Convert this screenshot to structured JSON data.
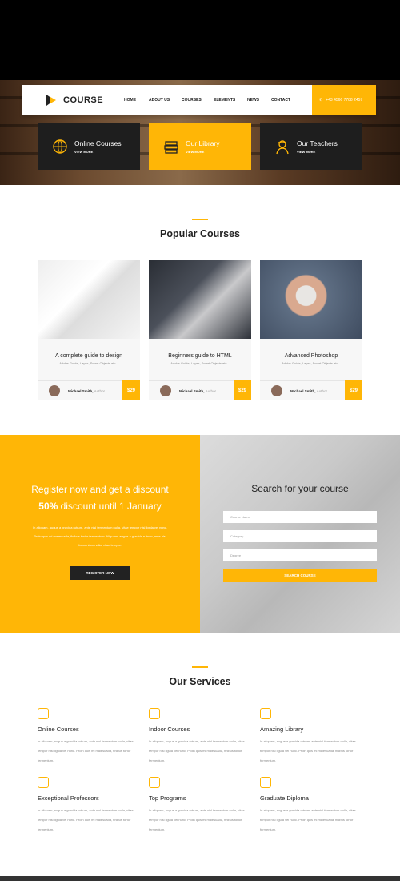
{
  "header": {
    "logo_text": "COURSE",
    "nav": [
      "HOME",
      "ABOUT US",
      "COURSES",
      "ELEMENTS",
      "NEWS",
      "CONTACT"
    ],
    "phone": "+43 4566 7788 2457"
  },
  "features": [
    {
      "title": "Online Courses",
      "link": "VIEW MORE",
      "icon": "globe-icon"
    },
    {
      "title": "Our Library",
      "link": "VIEW MORE",
      "icon": "books-icon"
    },
    {
      "title": "Our Teachers",
      "link": "VIEW MORE",
      "icon": "teacher-icon"
    }
  ],
  "popular": {
    "title": "Popular Courses",
    "cards": [
      {
        "title": "A complete guide to design",
        "subtitle": "Adobe Guide, Layes, Smart Objects etc...",
        "author": "Michael Smith,",
        "role": "Author",
        "price": "$29"
      },
      {
        "title": "Beginners guide to HTML",
        "subtitle": "Adobe Guide, Layes, Smart Objects etc...",
        "author": "Michael Smith,",
        "role": "Author",
        "price": "$29"
      },
      {
        "title": "Advanced Photoshop",
        "subtitle": "Adobe Guide, Layes, Smart Objects etc...",
        "author": "Michael Smith,",
        "role": "Author",
        "price": "$29"
      }
    ]
  },
  "register": {
    "line1": "Register now and get a discount",
    "line2_bold": "50%",
    "line2_rest": " discount until 1 January",
    "body": "In aliquam, augue a gravida rutrum, ante nisl fermentum nulla, vitae tempor nisl ligula vel nunc. Proin quis mi malesuada, finibus tortor fermentum. Aliquam, augue a gravida rutrum, ante nisl fermentum nulla, vitae tempor.",
    "button": "REGISTER NOW"
  },
  "search": {
    "title": "Search for your course",
    "fields": [
      "Course Name",
      "Category",
      "Degree"
    ],
    "button": "SEARCH COURSE"
  },
  "services": {
    "title": "Our Services",
    "items": [
      {
        "title": "Online Courses",
        "body": "In aliquam, augue a gravida rutrum, ante nisl fermentum nulla, vitae tempor nisl ligula vel nunc. Proin quis mi malesuada, finibus tortor fermentum."
      },
      {
        "title": "Indoor Courses",
        "body": "In aliquam, augue a gravida rutrum, ante nisl fermentum nulla, vitae tempor nisl ligula vel nunc. Proin quis mi malesuada, finibus tortor fermentum."
      },
      {
        "title": "Amazing Library",
        "body": "In aliquam, augue a gravida rutrum, ante nisl fermentum nulla, vitae tempor nisl ligula vel nunc. Proin quis mi malesuada, finibus tortor fermentum."
      },
      {
        "title": "Exceptional Professors",
        "body": "In aliquam, augue a gravida rutrum, ante nisl fermentum nulla, vitae tempor nisl ligula vel nunc. Proin quis mi malesuada, finibus tortor fermentum."
      },
      {
        "title": "Top Programs",
        "body": "In aliquam, augue a gravida rutrum, ante nisl fermentum nulla, vitae tempor nisl ligula vel nunc. Proin quis mi malesuada, finibus tortor fermentum."
      },
      {
        "title": "Graduate Diploma",
        "body": "In aliquam, augue a gravida rutrum, ante nisl fermentum nulla, vitae tempor nisl ligula vel nunc. Proin quis mi malesuada, finibus tortor fermentum."
      }
    ]
  },
  "colors": {
    "accent": "#ffb606",
    "dark": "#1e1e1e"
  }
}
